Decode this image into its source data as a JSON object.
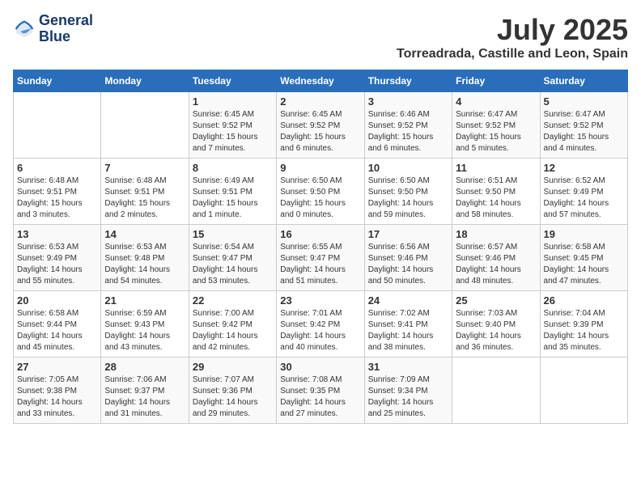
{
  "logo": {
    "line1": "General",
    "line2": "Blue"
  },
  "title": "July 2025",
  "location": "Torreadrada, Castille and Leon, Spain",
  "days_of_week": [
    "Sunday",
    "Monday",
    "Tuesday",
    "Wednesday",
    "Thursday",
    "Friday",
    "Saturday"
  ],
  "weeks": [
    [
      {
        "day": "",
        "info": ""
      },
      {
        "day": "",
        "info": ""
      },
      {
        "day": "1",
        "info": "Sunrise: 6:45 AM\nSunset: 9:52 PM\nDaylight: 15 hours and 7 minutes."
      },
      {
        "day": "2",
        "info": "Sunrise: 6:45 AM\nSunset: 9:52 PM\nDaylight: 15 hours and 6 minutes."
      },
      {
        "day": "3",
        "info": "Sunrise: 6:46 AM\nSunset: 9:52 PM\nDaylight: 15 hours and 6 minutes."
      },
      {
        "day": "4",
        "info": "Sunrise: 6:47 AM\nSunset: 9:52 PM\nDaylight: 15 hours and 5 minutes."
      },
      {
        "day": "5",
        "info": "Sunrise: 6:47 AM\nSunset: 9:52 PM\nDaylight: 15 hours and 4 minutes."
      }
    ],
    [
      {
        "day": "6",
        "info": "Sunrise: 6:48 AM\nSunset: 9:51 PM\nDaylight: 15 hours and 3 minutes."
      },
      {
        "day": "7",
        "info": "Sunrise: 6:48 AM\nSunset: 9:51 PM\nDaylight: 15 hours and 2 minutes."
      },
      {
        "day": "8",
        "info": "Sunrise: 6:49 AM\nSunset: 9:51 PM\nDaylight: 15 hours and 1 minute."
      },
      {
        "day": "9",
        "info": "Sunrise: 6:50 AM\nSunset: 9:50 PM\nDaylight: 15 hours and 0 minutes."
      },
      {
        "day": "10",
        "info": "Sunrise: 6:50 AM\nSunset: 9:50 PM\nDaylight: 14 hours and 59 minutes."
      },
      {
        "day": "11",
        "info": "Sunrise: 6:51 AM\nSunset: 9:50 PM\nDaylight: 14 hours and 58 minutes."
      },
      {
        "day": "12",
        "info": "Sunrise: 6:52 AM\nSunset: 9:49 PM\nDaylight: 14 hours and 57 minutes."
      }
    ],
    [
      {
        "day": "13",
        "info": "Sunrise: 6:53 AM\nSunset: 9:49 PM\nDaylight: 14 hours and 55 minutes."
      },
      {
        "day": "14",
        "info": "Sunrise: 6:53 AM\nSunset: 9:48 PM\nDaylight: 14 hours and 54 minutes."
      },
      {
        "day": "15",
        "info": "Sunrise: 6:54 AM\nSunset: 9:47 PM\nDaylight: 14 hours and 53 minutes."
      },
      {
        "day": "16",
        "info": "Sunrise: 6:55 AM\nSunset: 9:47 PM\nDaylight: 14 hours and 51 minutes."
      },
      {
        "day": "17",
        "info": "Sunrise: 6:56 AM\nSunset: 9:46 PM\nDaylight: 14 hours and 50 minutes."
      },
      {
        "day": "18",
        "info": "Sunrise: 6:57 AM\nSunset: 9:46 PM\nDaylight: 14 hours and 48 minutes."
      },
      {
        "day": "19",
        "info": "Sunrise: 6:58 AM\nSunset: 9:45 PM\nDaylight: 14 hours and 47 minutes."
      }
    ],
    [
      {
        "day": "20",
        "info": "Sunrise: 6:58 AM\nSunset: 9:44 PM\nDaylight: 14 hours and 45 minutes."
      },
      {
        "day": "21",
        "info": "Sunrise: 6:59 AM\nSunset: 9:43 PM\nDaylight: 14 hours and 43 minutes."
      },
      {
        "day": "22",
        "info": "Sunrise: 7:00 AM\nSunset: 9:42 PM\nDaylight: 14 hours and 42 minutes."
      },
      {
        "day": "23",
        "info": "Sunrise: 7:01 AM\nSunset: 9:42 PM\nDaylight: 14 hours and 40 minutes."
      },
      {
        "day": "24",
        "info": "Sunrise: 7:02 AM\nSunset: 9:41 PM\nDaylight: 14 hours and 38 minutes."
      },
      {
        "day": "25",
        "info": "Sunrise: 7:03 AM\nSunset: 9:40 PM\nDaylight: 14 hours and 36 minutes."
      },
      {
        "day": "26",
        "info": "Sunrise: 7:04 AM\nSunset: 9:39 PM\nDaylight: 14 hours and 35 minutes."
      }
    ],
    [
      {
        "day": "27",
        "info": "Sunrise: 7:05 AM\nSunset: 9:38 PM\nDaylight: 14 hours and 33 minutes."
      },
      {
        "day": "28",
        "info": "Sunrise: 7:06 AM\nSunset: 9:37 PM\nDaylight: 14 hours and 31 minutes."
      },
      {
        "day": "29",
        "info": "Sunrise: 7:07 AM\nSunset: 9:36 PM\nDaylight: 14 hours and 29 minutes."
      },
      {
        "day": "30",
        "info": "Sunrise: 7:08 AM\nSunset: 9:35 PM\nDaylight: 14 hours and 27 minutes."
      },
      {
        "day": "31",
        "info": "Sunrise: 7:09 AM\nSunset: 9:34 PM\nDaylight: 14 hours and 25 minutes."
      },
      {
        "day": "",
        "info": ""
      },
      {
        "day": "",
        "info": ""
      }
    ]
  ]
}
